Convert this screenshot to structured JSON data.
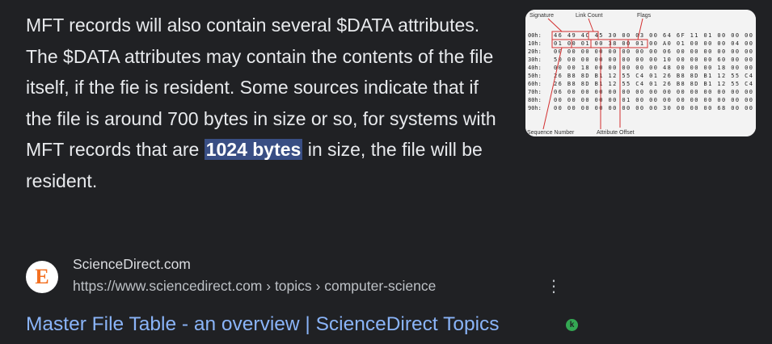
{
  "snippet": {
    "text_before": "MFT records will also contain several $DATA attributes. The $DATA attributes may contain the contents of the file itself, if the fie is resident. Some sources indicate that if the file is around 700 bytes in size or so, for systems with MFT records that are ",
    "highlight": "1024 bytes",
    "text_after": " in size, the file will be resident."
  },
  "thumbnail": {
    "label_signature": "Signature",
    "label_link_count": "Link Count",
    "label_flags": "Flags",
    "label_sequence_number": "Sequence Number",
    "label_attribute_offset": "Attribute Offset",
    "hex_rows": [
      {
        "offset": "00h:",
        "bytes": "46 49 4C 45 30 00 03 00 64 6F 11 01 00 00 00"
      },
      {
        "offset": "10h:",
        "bytes": "01 00 01 00 38 00 01 00 A0 01 00 00 00 04 00"
      },
      {
        "offset": "20h:",
        "bytes": "00 00 00 00 00 00 00 00 06 00 00 00 00 00 00"
      },
      {
        "offset": "30h:",
        "bytes": "50 00 00 00 00 00 00 00 10 00 00 00 60 00 00"
      },
      {
        "offset": "40h:",
        "bytes": "00 00 18 00 00 00 00 00 48 00 00 00 18 00 00"
      },
      {
        "offset": "50h:",
        "bytes": "26 B8 8D B1 12 55 C4 01 26 B8 8D B1 12 55 C4"
      },
      {
        "offset": "60h:",
        "bytes": "26 B8 8D B1 12 55 C4 01 26 B8 8D B1 12 55 C4"
      },
      {
        "offset": "70h:",
        "bytes": "06 00 00 00 00 00 00 00 00 00 00 00 00 00 00"
      },
      {
        "offset": "80h:",
        "bytes": "00 00 00 00 00 01 00 00 00 00 00 00 00 00 00"
      },
      {
        "offset": "90h:",
        "bytes": "00 00 00 00 00 00 00 00 30 00 00 00 68 00 00"
      }
    ]
  },
  "source": {
    "favicon_letter": "E",
    "site_name": "ScienceDirect.com",
    "url": "https://www.sciencedirect.com › topics › computer-science",
    "more_glyph": "⋮"
  },
  "result": {
    "title": "Master File Table - an overview | ScienceDirect Topics",
    "badge_letter": "k"
  },
  "colors": {
    "background": "#202124",
    "snippet_text": "#e8eaed",
    "highlight_bg": "#394e84",
    "link": "#8ab4f8",
    "favicon_brand": "#f37021",
    "badge": "#34a853"
  }
}
